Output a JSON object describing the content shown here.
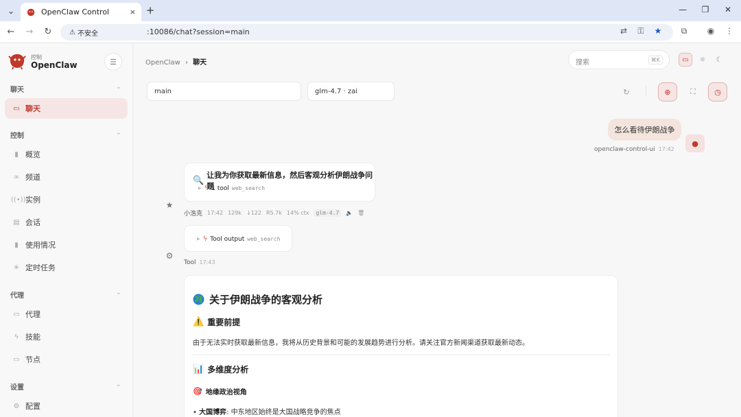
{
  "browser": {
    "tab_title": "OpenClaw Control",
    "tab_close": "×",
    "new_tab": "+",
    "security_label": "不安全",
    "url": ":10086/chat?session=main"
  },
  "sidebar": {
    "brand_sub": "控制",
    "brand": "OpenClaw",
    "sections": [
      {
        "label": "聊天",
        "items": [
          {
            "label": "聊天",
            "icon": "chat-icon"
          }
        ]
      },
      {
        "label": "控制",
        "items": [
          {
            "label": "概览",
            "icon": "bar-chart-icon"
          },
          {
            "label": "频道",
            "icon": "link-icon"
          },
          {
            "label": "实例",
            "icon": "broadcast-icon"
          },
          {
            "label": "会话",
            "icon": "document-icon"
          },
          {
            "label": "使用情况",
            "icon": "bar-chart-icon"
          },
          {
            "label": "定时任务",
            "icon": "loader-icon"
          }
        ]
      },
      {
        "label": "代理",
        "items": [
          {
            "label": "代理",
            "icon": "folder-icon"
          },
          {
            "label": "技能",
            "icon": "bolt-icon"
          },
          {
            "label": "节点",
            "icon": "monitor-icon"
          }
        ]
      },
      {
        "label": "设置",
        "items": [
          {
            "label": "配置",
            "icon": "gear-icon"
          }
        ]
      }
    ]
  },
  "header": {
    "breadcrumb_root": "OpenClaw",
    "breadcrumb_sep": "›",
    "breadcrumb_current": "聊天",
    "search_placeholder": "搜索",
    "search_shortcut": "⌘K"
  },
  "toolbar": {
    "session": "main",
    "model": "glm-4.7 · zai"
  },
  "chat": {
    "user_message": "怎么看待伊朗战争",
    "user_name": "openclaw-control-ui",
    "user_time": "17:42",
    "assistant_title": "让我为你获取最新信息，然后客观分析伊朗战争问题",
    "assistant_tool_count": "1 tool",
    "assistant_tool_name": "web_search",
    "assistant_name": "小浩克",
    "assistant_time": "17:42",
    "assistant_stats": [
      "129k",
      "↓122",
      "R5.7k",
      "14% ctx"
    ],
    "assistant_model": "glm-4.7",
    "tool_output_label": "Tool output",
    "tool_output_name": "web_search",
    "tool_name": "Tool",
    "tool_time": "17:43",
    "doc": {
      "h1": "关于伊朗战争的客观分析",
      "h2_1": "重要前提",
      "para": "由于无法实时获取最新信息，我将从历史背景和可能的发展趋势进行分析。请关注官方新闻渠道获取最新动态。",
      "h2_2": "多维度分析",
      "h3": "地缘政治视角",
      "bullet_bold": "大国博弈",
      "bullet_text": ": 中东地区始终是大国战略竞争的焦点"
    }
  },
  "colors": {
    "accent": "#c0392b",
    "accent_bg": "#f5e6e5",
    "user_bubble": "#f3e4dd"
  }
}
